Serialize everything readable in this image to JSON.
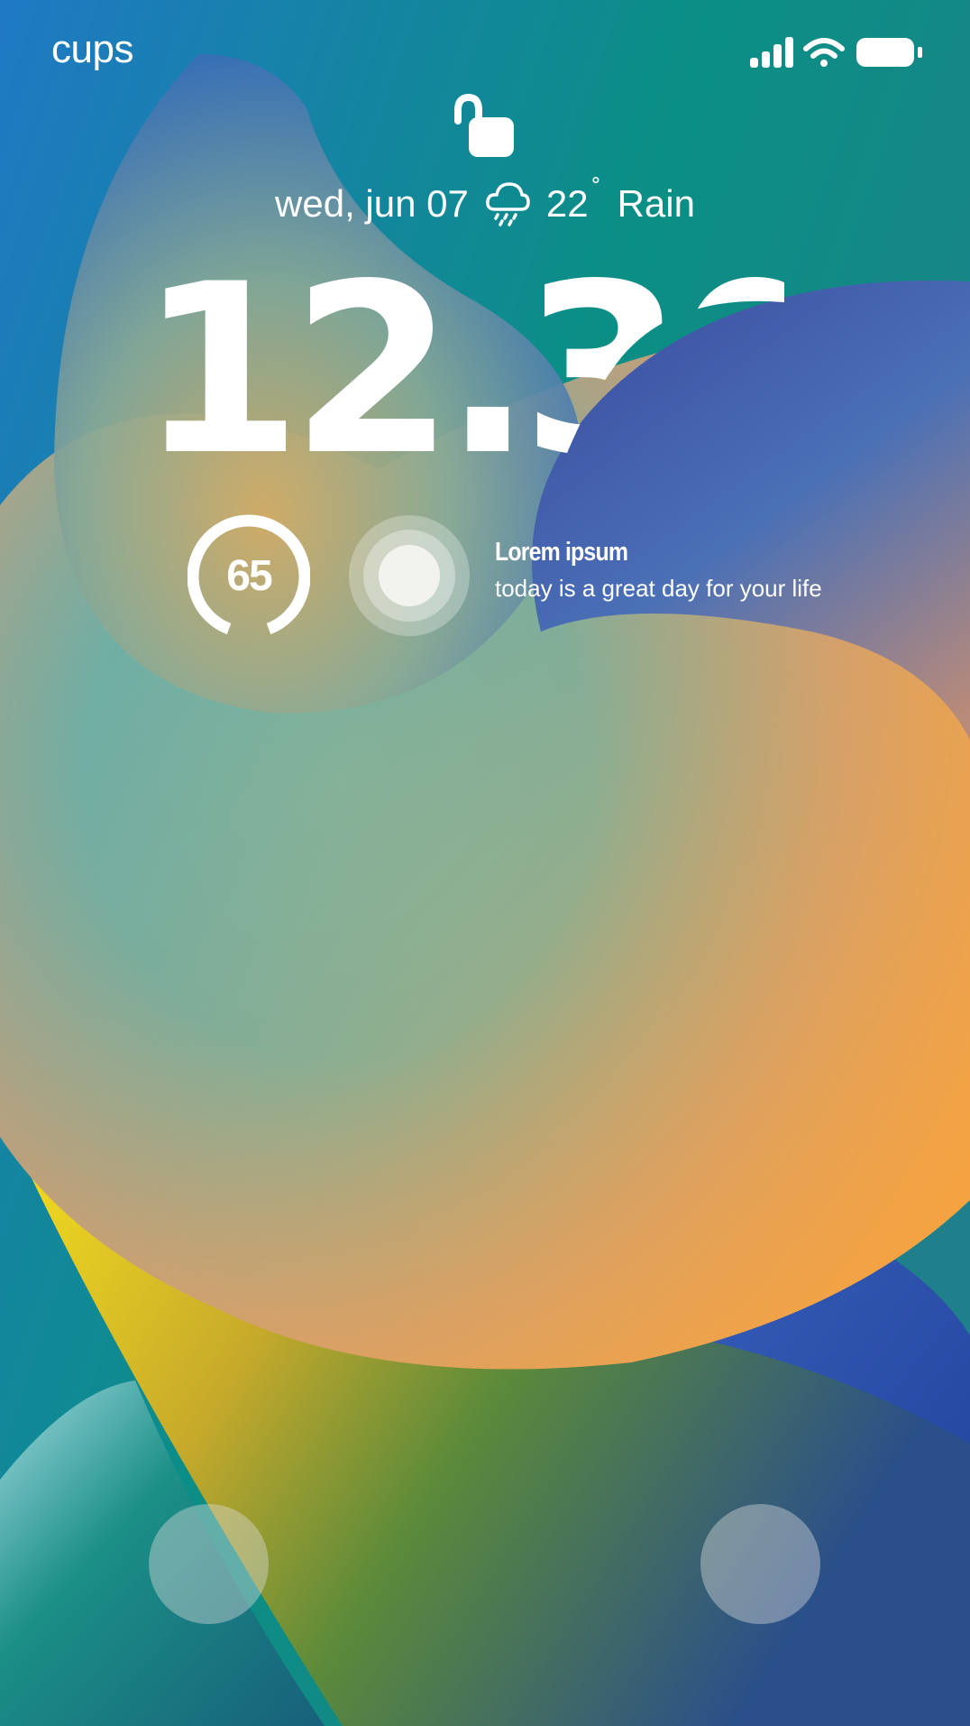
{
  "status_bar": {
    "carrier": "cups",
    "icons": [
      "signal-icon",
      "wifi-icon",
      "battery-icon"
    ]
  },
  "lock_icon": "lock-open-icon",
  "date_row": {
    "date": "wed, jun 07",
    "weather_icon": "rain-cloud-icon",
    "temperature": "22",
    "degree_symbol": "˚",
    "condition": "Rain"
  },
  "clock": {
    "time": "12.30"
  },
  "widgets": {
    "ring": {
      "value": "65"
    },
    "note": {
      "title": "Lorem ipsum",
      "body": "today is a great day for your life"
    }
  },
  "bottom_buttons": {
    "left": "flashlight-button",
    "right": "camera-button"
  },
  "colors": {
    "text": "#ffffff",
    "wallpaper_blue": "#1d6fbd",
    "wallpaper_teal": "#0f8a7e",
    "wallpaper_orange": "#f3a443",
    "wallpaper_yellow": "#f2d21e",
    "wallpaper_indigo": "#3b4b9d"
  }
}
